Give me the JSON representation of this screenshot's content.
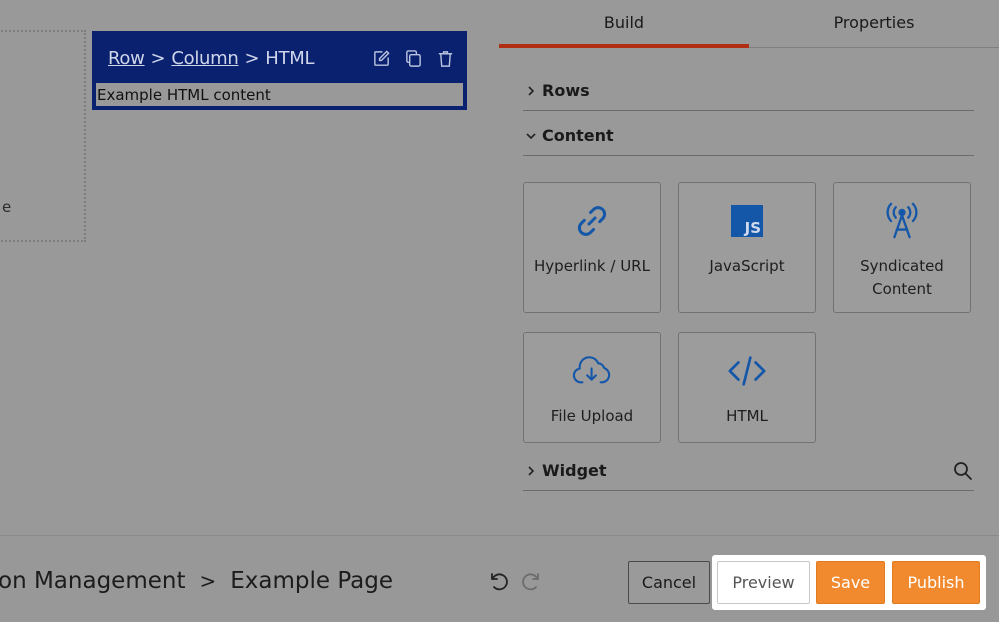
{
  "canvas": {
    "placeholder_text": "e",
    "html_block": {
      "breadcrumb": {
        "row": "Row",
        "column": "Column",
        "current": "HTML",
        "sep": ">"
      },
      "content": "Example HTML content",
      "actions": [
        "edit-icon",
        "copy-icon",
        "trash-icon"
      ]
    }
  },
  "panel": {
    "tabs": [
      {
        "label": "Build",
        "active": true
      },
      {
        "label": "Properties",
        "active": false
      }
    ],
    "sections": {
      "rows": {
        "label": "Rows",
        "expanded": false
      },
      "content": {
        "label": "Content",
        "expanded": true
      },
      "widget": {
        "label": "Widget",
        "expanded": false
      }
    },
    "tiles": [
      {
        "label": "Hyperlink / URL",
        "icon": "link-icon"
      },
      {
        "label": "JavaScript",
        "icon": "javascript-icon"
      },
      {
        "label": "Syndicated Content",
        "icon": "antenna-icon"
      },
      {
        "label": "File Upload",
        "icon": "cloud-download-icon"
      },
      {
        "label": "HTML",
        "icon": "code-icon"
      }
    ],
    "js_badge": "JS"
  },
  "footer": {
    "breadcrumb": {
      "parent": "on Management",
      "sep": ">",
      "current": "Example Page"
    },
    "buttons": {
      "cancel": "Cancel",
      "preview": "Preview",
      "save": "Save",
      "publish": "Publish"
    }
  },
  "colors": {
    "block_navy": "#0a2170",
    "tab_accent": "#b12d14",
    "icon_blue": "#1456a8",
    "action_orange": "#f18a2e"
  }
}
